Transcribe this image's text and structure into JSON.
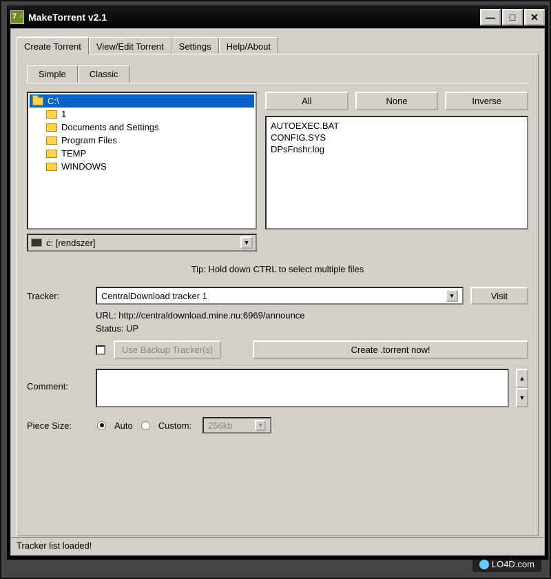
{
  "window": {
    "title": "MakeTorrent v2.1"
  },
  "tabs": {
    "items": [
      {
        "label": "Create Torrent"
      },
      {
        "label": "View/Edit Torrent"
      },
      {
        "label": "Settings"
      },
      {
        "label": "Help/About"
      }
    ]
  },
  "sub_tabs": {
    "items": [
      {
        "label": "Simple"
      },
      {
        "label": "Classic"
      }
    ]
  },
  "folder_tree": {
    "root": {
      "label": "C:\\"
    },
    "children": [
      {
        "label": "1"
      },
      {
        "label": "Documents and Settings"
      },
      {
        "label": "Program Files"
      },
      {
        "label": "TEMP"
      },
      {
        "label": "WINDOWS"
      }
    ]
  },
  "drive_select": {
    "value": "c: [rendszer]"
  },
  "select_buttons": {
    "all": "All",
    "none": "None",
    "inverse": "Inverse"
  },
  "file_list": [
    "AUTOEXEC.BAT",
    "CONFIG.SYS",
    "DPsFnshr.log"
  ],
  "tip": "Tip: Hold down CTRL to select multiple files",
  "tracker": {
    "label": "Tracker:",
    "value": "CentralDownload tracker 1",
    "visit_label": "Visit",
    "url_label": "URL: http://centraldownload.mine.nu:6969/announce",
    "status_label": "Status: UP",
    "backup_label": "Use Backup Tracker(s)",
    "create_label": "Create .torrent now!"
  },
  "comment": {
    "label": "Comment:"
  },
  "piece_size": {
    "label": "Piece Size:",
    "auto_label": "Auto",
    "custom_label": "Custom:",
    "custom_value": "256kb"
  },
  "statusbar": {
    "text": "Tracker list loaded!"
  },
  "watermark": {
    "text": "LO4D.com"
  }
}
